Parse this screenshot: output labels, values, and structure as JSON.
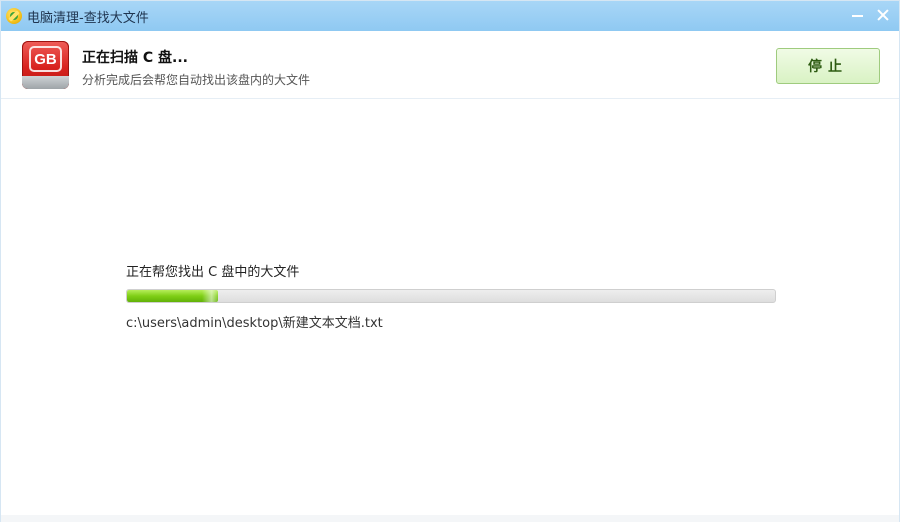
{
  "window": {
    "title": "电脑清理-查找大文件",
    "minimize_icon": "minimize-icon",
    "close_icon": "close-icon"
  },
  "header": {
    "icon_text": "GB",
    "title": "正在扫描 C 盘...",
    "subtitle": "分析完成后会帮您自动找出该盘内的大文件",
    "stop_button": "停止"
  },
  "scan": {
    "status": "正在帮您找出 C 盘中的大文件",
    "progress_percent": 14,
    "current_file": "c:\\users\\admin\\desktop\\新建文本文档.txt"
  },
  "colors": {
    "titlebar": "#9fd0f5",
    "progress_fill": "#7fcf16",
    "stop_button_bg": "#e4f6d4"
  }
}
